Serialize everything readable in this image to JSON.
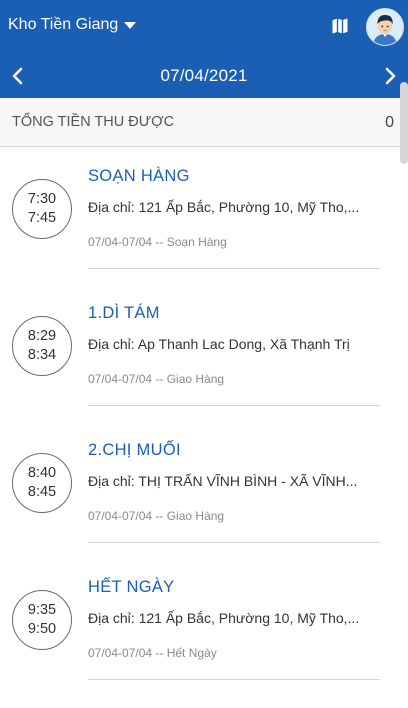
{
  "header": {
    "warehouse": "Kho Tiền Giang",
    "date": "07/04/2021",
    "icons": {
      "dropdown": "caret-down-icon",
      "map": "map-icon",
      "avatar": "avatar",
      "prev": "chevron-left-icon",
      "next": "chevron-right-icon"
    }
  },
  "summary": {
    "label": "TỔNG TIỀN THU ĐƯỢC",
    "value": "0"
  },
  "stops": [
    {
      "time_start": "7:30",
      "time_end": "7:45",
      "title": "SOẠN HÀNG",
      "address": "Địa chỉ: 121 Ấp Bắc, Phường 10, Mỹ Tho,...",
      "meta": "07/04-07/04 -- Soạn Hàng"
    },
    {
      "time_start": "8:29",
      "time_end": "8:34",
      "title": "1.DÌ TÁM",
      "address": "Địa chỉ: Ap Thanh Lac Dong, Xã Thạnh Trị",
      "meta": "07/04-07/04 -- Giao Hàng"
    },
    {
      "time_start": "8:40",
      "time_end": "8:45",
      "title": "2.CHỊ  MUỐI",
      "address": "Địa chỉ: THỊ TRẤN VĨNH BÌNH - XÃ VĨNH...",
      "meta": "07/04-07/04 -- Giao Hàng"
    },
    {
      "time_start": "9:35",
      "time_end": "9:50",
      "title": "HẾT NGÀY",
      "address": "Địa chỉ: 121 Ấp Bắc, Phường 10, Mỹ Tho,...",
      "meta": "07/04-07/04 -- Hết Ngày"
    }
  ],
  "colors": {
    "primary": "#1a5fb4",
    "title": "#1a5fb4",
    "meta": "#8a8a8a"
  }
}
